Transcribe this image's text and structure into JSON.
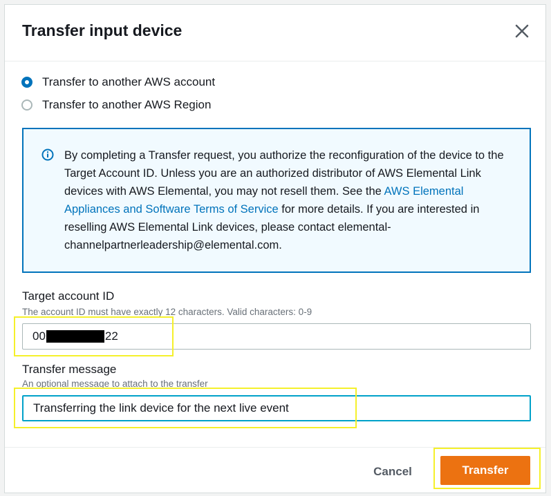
{
  "dialog": {
    "title": "Transfer input device",
    "close_icon": "close-icon"
  },
  "options": [
    {
      "label": "Transfer to another AWS account",
      "checked": true
    },
    {
      "label": "Transfer to another AWS Region",
      "checked": false
    }
  ],
  "info": {
    "icon": "info-icon",
    "text_before": "By completing a Transfer request, you authorize the reconfiguration of the device to the Target Account ID. Unless you are an authorized distributor of AWS Elemental Link devices with AWS Elemental, you may not resell them. See the ",
    "link": "AWS Elemental Appliances and Software Terms of Service",
    "text_after": " for more details. If you are interested in reselling AWS Elemental Link devices, please contact elemental-channelpartnerleadership@elemental.com."
  },
  "target_account": {
    "label": "Target account ID",
    "description": "The account ID must have exactly 12 characters. Valid characters: 0-9",
    "value_prefix": "00",
    "value_suffix": "22"
  },
  "transfer_message": {
    "label": "Transfer message",
    "description": "An optional message to attach to the transfer",
    "value": "Transferring the link device for the next live event"
  },
  "footer": {
    "cancel_label": "Cancel",
    "submit_label": "Transfer"
  },
  "colors": {
    "accent": "#0073bb",
    "primary_button": "#ec7211",
    "highlight": "#f5f02a"
  }
}
